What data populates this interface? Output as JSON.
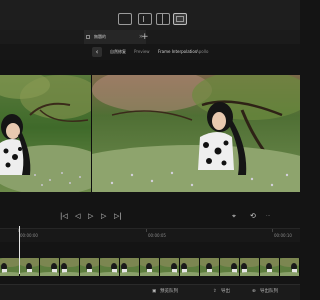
{
  "tabs": [
    {
      "label": "無題的",
      "active": true
    }
  ],
  "breadcrumb": {
    "segments": [
      "自然修复",
      "Preview",
      "Frame Interpolation",
      "Apollo"
    ]
  },
  "ruler": {
    "ticks": [
      "00:00:00",
      "00:00:05",
      "00:00:10"
    ]
  },
  "bottom_bar": {
    "preview_queue_label": "预览队列",
    "export_label": "导出",
    "export_queue_label": "导出队列"
  },
  "colors": {
    "accent": "#e5e5e5",
    "background": "#141414",
    "panel": "#1e1e1e"
  },
  "icons": [
    "view-single-icon",
    "view-side-icon",
    "view-split-icon",
    "view-grid-icon",
    "back-arrow-icon",
    "prev-frame-icon",
    "rewind-icon",
    "play-icon",
    "forward-icon",
    "next-frame-icon",
    "crop-icon",
    "loop-icon",
    "more-icon",
    "preview-queue-icon",
    "export-icon",
    "export-queue-icon"
  ]
}
